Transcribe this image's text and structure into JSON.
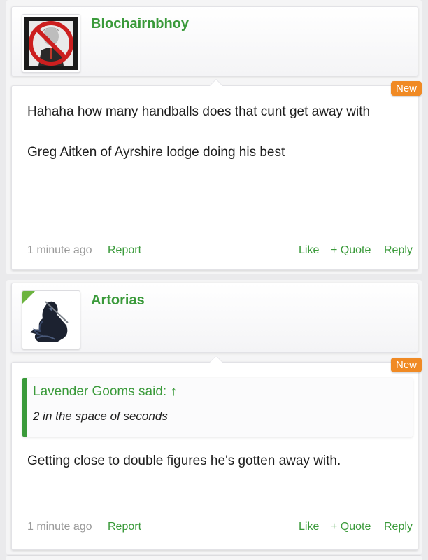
{
  "posts": [
    {
      "username": "Blochairnbhoy",
      "badge": "New",
      "lines": [
        "Hahaha how many handballs does that cunt get away with",
        "Greg Aitken of Ayrshire lodge doing his best"
      ],
      "time": "1 minute ago",
      "actions": {
        "report": "Report",
        "like": "Like",
        "quote": "+ Quote",
        "reply": "Reply"
      }
    },
    {
      "username": "Artorias",
      "badge": "New",
      "quote": {
        "attribution": "Lavender Gooms said: ↑",
        "text": "2 in the space of seconds"
      },
      "lines": [
        "Getting close to double figures he's gotten away with."
      ],
      "time": "1 minute ago",
      "actions": {
        "report": "Report",
        "like": "Like",
        "quote": "+ Quote",
        "reply": "Reply"
      }
    }
  ],
  "colors": {
    "accent": "#3a9a3a",
    "new_badge": "#f08a24",
    "online_indicator": "#6cb33f",
    "timestamp": "#9a9a9a"
  }
}
